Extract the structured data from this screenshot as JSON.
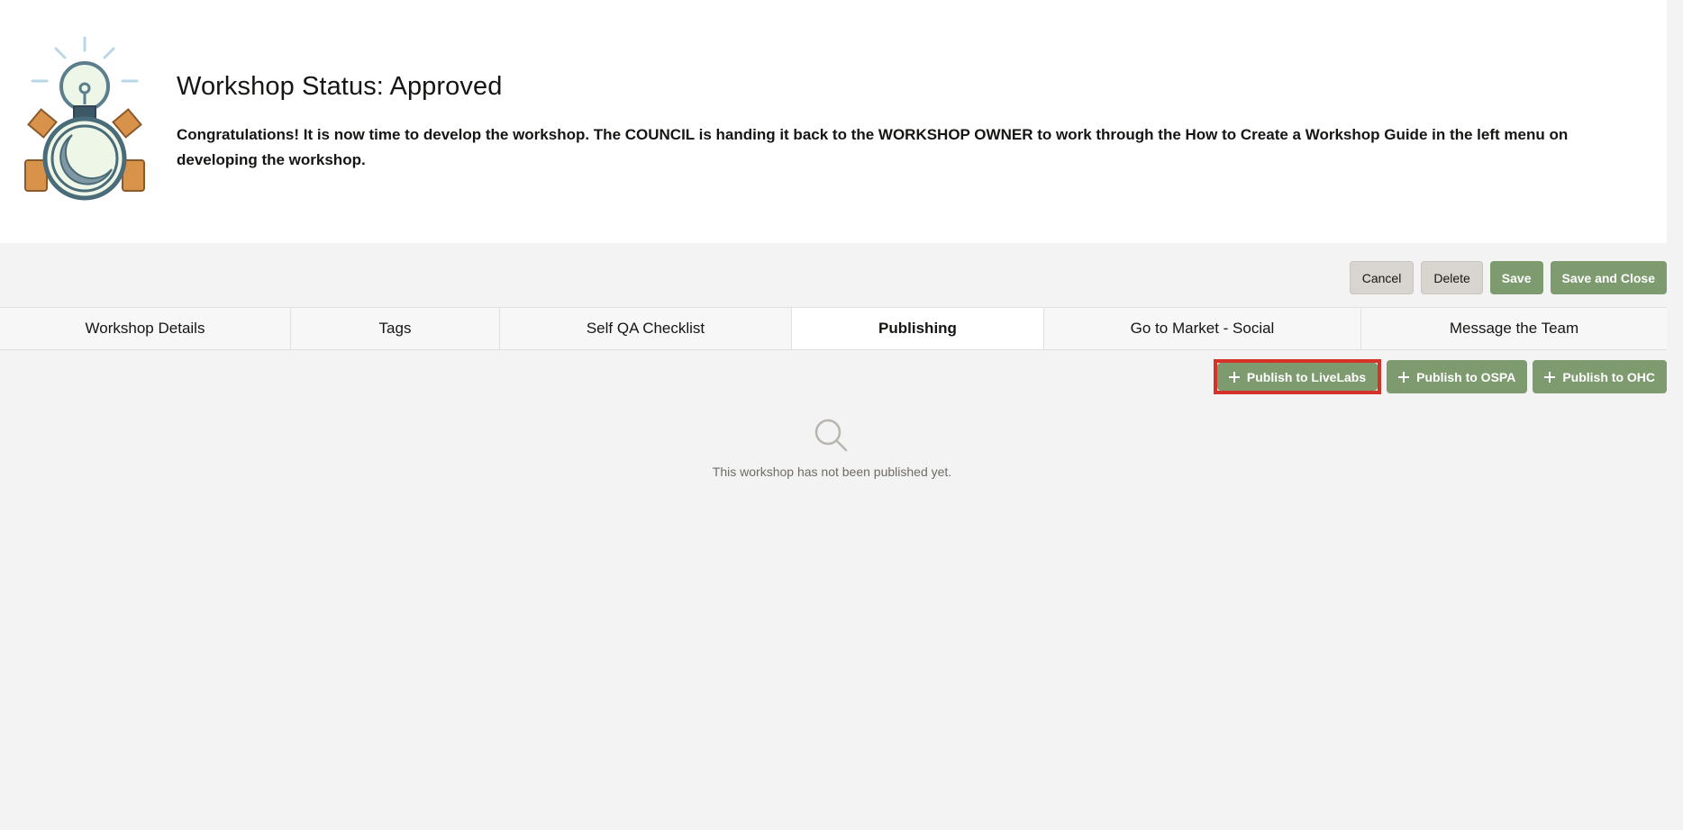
{
  "status": {
    "title": "Workshop Status: Approved",
    "message": "Congratulations! It is now time to develop the workshop. The COUNCIL is handing it back to the WORKSHOP OWNER to work through the How to Create a Workshop Guide in the left menu on developing the workshop."
  },
  "toolbar": {
    "cancel_label": "Cancel",
    "delete_label": "Delete",
    "save_label": "Save",
    "save_close_label": "Save and Close"
  },
  "tabs": [
    {
      "label": "Workshop Details",
      "active": false
    },
    {
      "label": "Tags",
      "active": false
    },
    {
      "label": "Self QA Checklist",
      "active": false
    },
    {
      "label": "Publishing",
      "active": true
    },
    {
      "label": "Go to Market - Social",
      "active": false
    },
    {
      "label": "Message the Team",
      "active": false
    }
  ],
  "publishing": {
    "livelabs_label": "Publish to LiveLabs",
    "ospa_label": "Publish to OSPA",
    "ohc_label": "Publish to OHC",
    "empty_icon": "search-icon",
    "empty_text": "This workshop has not been published yet."
  },
  "colors": {
    "primary": "#7d9b6f",
    "neutral": "#d8d4cf",
    "highlight": "#d5322a",
    "background": "#f3f3f3"
  }
}
